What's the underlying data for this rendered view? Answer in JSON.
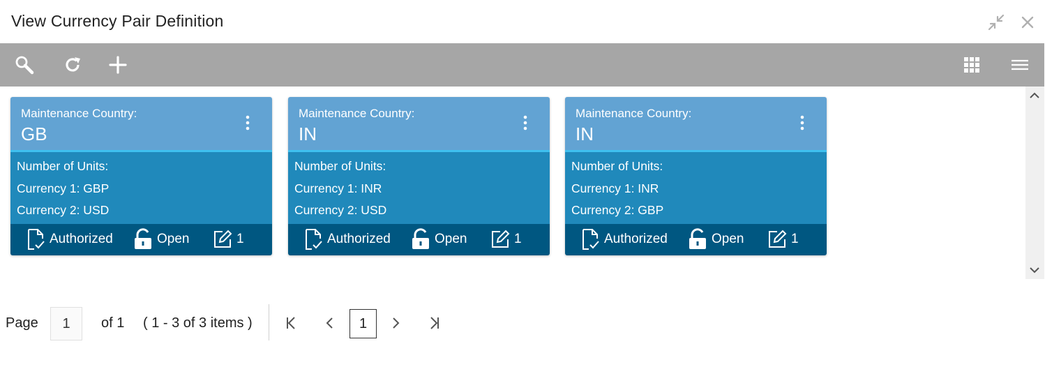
{
  "window": {
    "title": "View Currency Pair Definition"
  },
  "icons": {
    "minimize": "minimize-arrows-icon",
    "close": "close-icon",
    "search": "search-icon",
    "refresh": "refresh-icon",
    "add": "add-icon",
    "grid": "grid-view-icon",
    "menu": "list-menu-icon",
    "authorized": "authorized-document-icon",
    "open": "unlock-icon",
    "version": "edit-icon",
    "kebab": "kebab-menu-icon"
  },
  "colors": {
    "toolbar": "#a6a6a6",
    "card_head": "#62a3d3",
    "card_head_border": "#3fc0ef",
    "card_body": "#2089bb",
    "card_foot": "#005781"
  },
  "cards": [
    {
      "head_label": "Maintenance Country:",
      "head_value": "GB",
      "units_label": "Number of Units:",
      "currency1": "Currency 1:  GBP",
      "currency2": "Currency 2:  USD",
      "status": "Authorized",
      "lock": "Open",
      "version": "1"
    },
    {
      "head_label": "Maintenance Country:",
      "head_value": "IN",
      "units_label": "Number of Units:",
      "currency1": "Currency 1:  INR",
      "currency2": "Currency 2:  USD",
      "status": "Authorized",
      "lock": "Open",
      "version": "1"
    },
    {
      "head_label": "Maintenance Country:",
      "head_value": "IN",
      "units_label": "Number of Units:",
      "currency1": "Currency 1:  INR",
      "currency2": "Currency 2:  GBP",
      "status": "Authorized",
      "lock": "Open",
      "version": "1"
    }
  ],
  "pagination": {
    "page_label": "Page",
    "page_input": "1",
    "of_label": "of 1",
    "items_label": "( 1 - 3 of 3 items )",
    "current": "1"
  }
}
